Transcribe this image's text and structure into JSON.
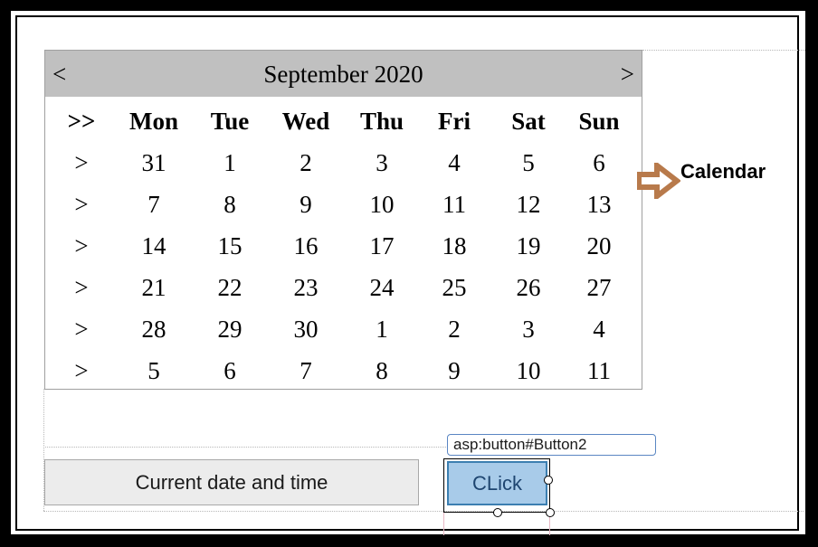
{
  "calendar": {
    "prev": "<",
    "title": "September 2020",
    "next": ">",
    "select_all": ">>",
    "days_of_week": [
      "Mon",
      "Tue",
      "Wed",
      "Thu",
      "Fri",
      "Sat",
      "Sun"
    ],
    "week_selector": ">",
    "weeks": [
      [
        "31",
        "1",
        "2",
        "3",
        "4",
        "5",
        "6"
      ],
      [
        "7",
        "8",
        "9",
        "10",
        "11",
        "12",
        "13"
      ],
      [
        "14",
        "15",
        "16",
        "17",
        "18",
        "19",
        "20"
      ],
      [
        "21",
        "22",
        "23",
        "24",
        "25",
        "26",
        "27"
      ],
      [
        "28",
        "29",
        "30",
        "1",
        "2",
        "3",
        "4"
      ],
      [
        "5",
        "6",
        "7",
        "8",
        "9",
        "10",
        "11"
      ]
    ]
  },
  "annotation": {
    "label": "Calendar",
    "arrow_color": "#b87a4b"
  },
  "buttons": {
    "current_label": "Current date and time",
    "click_label": "CLick"
  },
  "designer_tag": "asp:button#Button2"
}
